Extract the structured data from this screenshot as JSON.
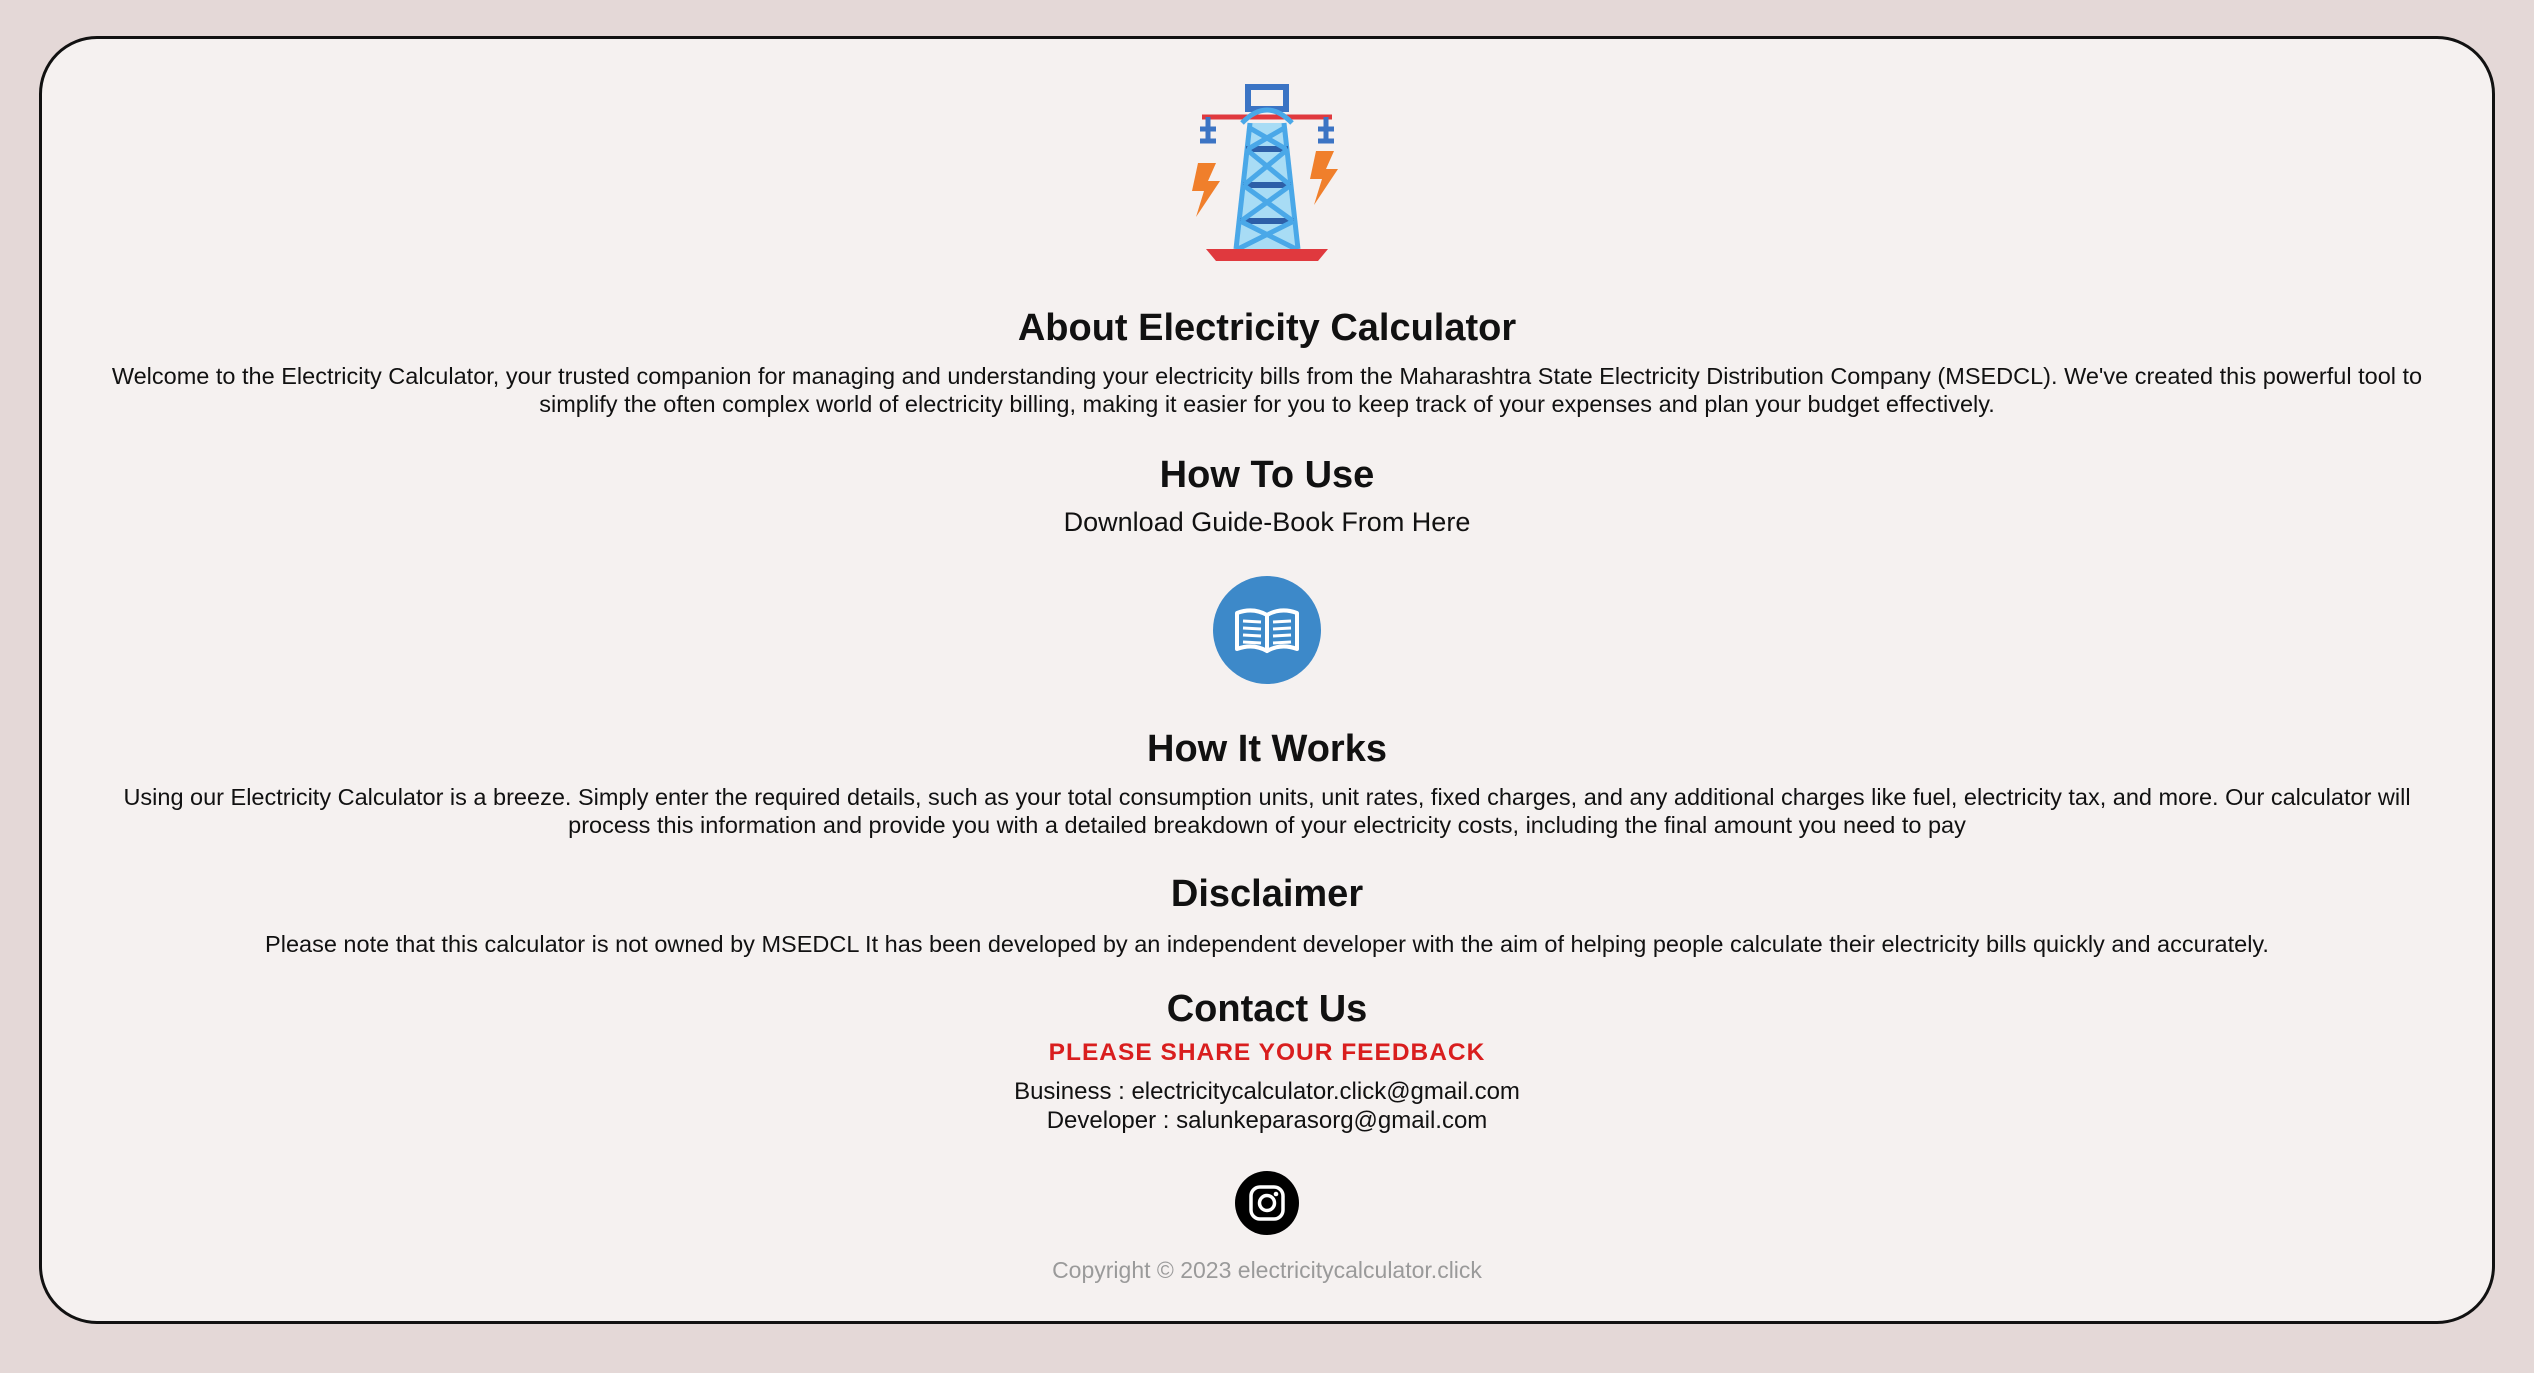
{
  "logo": {
    "icon": "electricity-tower-icon"
  },
  "about": {
    "title": "About Electricity Calculator",
    "text": "Welcome to the Electricity Calculator, your trusted companion for managing and understanding your electricity bills from the Maharashtra State Electricity Distribution Company (MSEDCL). We've created this powerful tool to simplify the often complex world of electricity billing, making it easier for you to keep track of your expenses and plan your budget effectively."
  },
  "how_to_use": {
    "title": "How To Use",
    "text": "Download Guide-Book From Here",
    "icon": "book-icon",
    "button_color": "#3d89c9"
  },
  "how_it_works": {
    "title": "How It Works",
    "text": "Using our Electricity Calculator is a breeze. Simply enter the required details, such as your total consumption units, unit rates, fixed charges, and any additional charges like fuel, electricity tax, and more. Our calculator will process this information and provide you with a detailed breakdown of your electricity costs, including the final amount you need to pay"
  },
  "disclaimer": {
    "title": "Disclaimer",
    "text": "Please note that this calculator is not owned by MSEDCL It has been developed by an independent developer with the aim of helping people calculate their electricity bills quickly and accurately."
  },
  "contact": {
    "title": "Contact Us",
    "feedback": "PLEASE SHARE YOUR FEEDBACK",
    "feedback_color": "#d91e1e",
    "business_label": "Business : ",
    "business_email": "electricitycalculator.click@gmail.com",
    "developer_label": "Developer : ",
    "developer_email": "salunkeparasorg@gmail.com",
    "social_icon": "instagram-icon"
  },
  "footer": {
    "copyright": "Copyright © 2023 electricitycalculator.click"
  },
  "colors": {
    "page_background": "#e4d8d7",
    "card_background": "#f5f1f0"
  }
}
